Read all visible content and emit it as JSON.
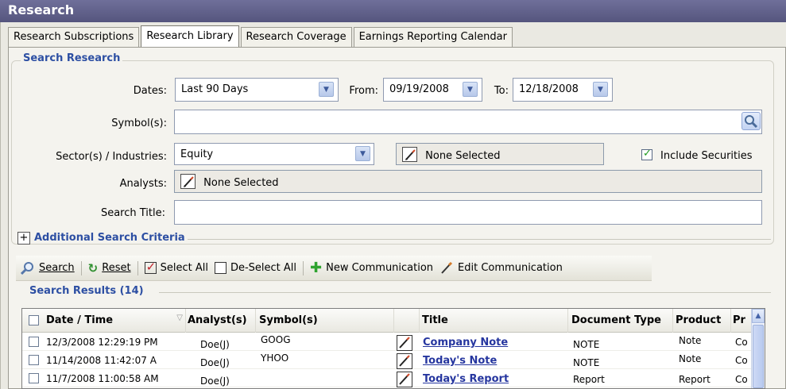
{
  "window": {
    "title": "Research"
  },
  "tabs": [
    {
      "label": "Research Subscriptions"
    },
    {
      "label": "Research Library"
    },
    {
      "label": "Research Coverage"
    },
    {
      "label": "Earnings Reporting Calendar"
    }
  ],
  "search_group": {
    "title": "Search Research"
  },
  "form": {
    "dates_label": "Dates:",
    "dates_value": "Last 90 Days",
    "from_label": "From:",
    "from_value": "09/19/2008",
    "to_label": "To:",
    "to_value": "12/18/2008",
    "symbols_label": "Symbol(s):",
    "symbols_value": "",
    "sector_label": "Sector(s) / Industries:",
    "sector_value": "Equity",
    "industries_value": "None Selected",
    "include_securities_label": "Include Securities",
    "include_securities_checked": true,
    "analysts_label": "Analysts:",
    "analysts_value": "None Selected",
    "search_title_label": "Search Title:",
    "search_title_value": ""
  },
  "additional_criteria": {
    "label": "Additional Search Criteria",
    "expander": "+"
  },
  "toolbar": {
    "search": "Search",
    "reset": "Reset",
    "select_all": "Select All",
    "deselect_all": "De-Select All",
    "new_communication": "New Communication",
    "edit_communication": "Edit Communication"
  },
  "results": {
    "title": "Search Results (14)",
    "columns": [
      "Date / Time",
      "Analyst(s)",
      "Symbol(s)",
      "Title",
      "Document Type",
      "Product",
      "Pr"
    ],
    "rows": [
      {
        "date": "12/3/2008 12:29:19 PM",
        "analyst": "Doe(J)",
        "symbol": "GOOG",
        "title": "Company Note",
        "doc_type": "NOTE",
        "product": "Note",
        "pr": "Co"
      },
      {
        "date": "11/14/2008 11:42:07 A",
        "analyst": "Doe(J)",
        "symbol": "YHOO",
        "title": "Today's Note",
        "doc_type": "NOTE",
        "product": "Note",
        "pr": "Co"
      },
      {
        "date": "11/7/2008 11:00:58 AM",
        "analyst": "Doe(J)",
        "symbol": "",
        "title": "Today's Report",
        "doc_type": "Report",
        "product": "Report",
        "pr": "Co"
      }
    ]
  },
  "colors": {
    "title_bar": "#5f5f8a",
    "accent_blue": "#2d4fa3",
    "link": "#26369f",
    "check_green": "#1f9a1f"
  },
  "icons": [
    "search-icon",
    "magnifier-icon",
    "refresh-icon",
    "checkbox-checked-icon",
    "checkbox-empty-icon",
    "plus-icon",
    "pencil-icon",
    "dropdown-arrow-icon",
    "scroll-up-icon",
    "sort-icon"
  ]
}
